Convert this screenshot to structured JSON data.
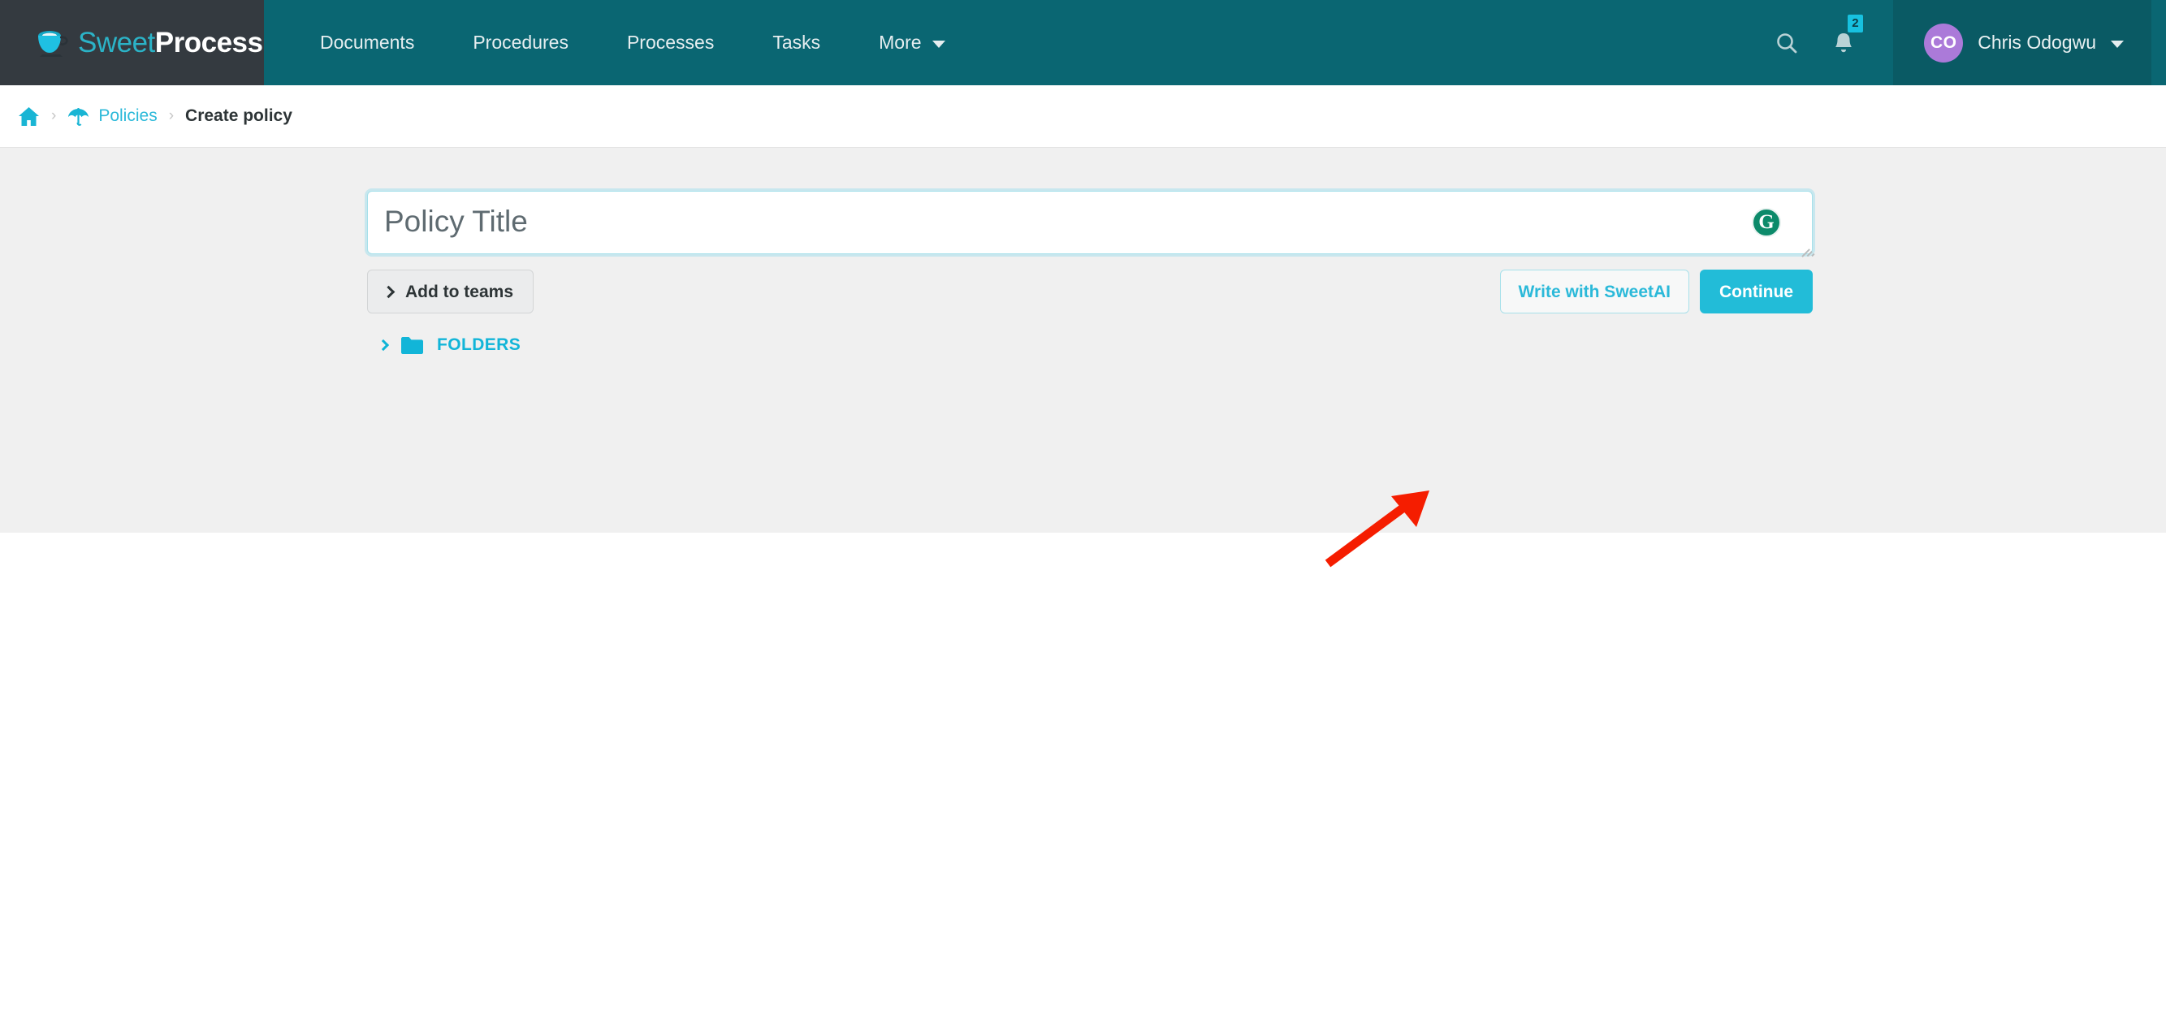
{
  "brand": {
    "name_part1": "Sweet",
    "name_part2": "Process",
    "logo_icon": "coffee-cup-icon",
    "accent_color": "#2bb3c7",
    "header_color": "#0a6672",
    "logo_panel_color": "#343a40"
  },
  "nav": {
    "items": [
      {
        "label": "Documents"
      },
      {
        "label": "Procedures"
      },
      {
        "label": "Processes"
      },
      {
        "label": "Tasks"
      },
      {
        "label": "More",
        "has_dropdown": true
      }
    ],
    "search_icon": "search-icon",
    "notifications_icon": "bell-icon",
    "notifications_count": "2",
    "notification_badge_color": "#17c1e0"
  },
  "user": {
    "initials": "CO",
    "name": "Chris Odogwu",
    "avatar_color": "#ab7ad9",
    "dropdown_icon": "chevron-down-icon"
  },
  "breadcrumb": {
    "home_icon": "home-icon",
    "separator": "›",
    "items": [
      {
        "label": "Policies",
        "icon": "umbrella-icon",
        "is_link": true
      },
      {
        "label": "Create policy",
        "is_link": false
      }
    ]
  },
  "form": {
    "title_input": {
      "value": "",
      "placeholder": "Policy Title"
    },
    "grammarly_icon": "grammarly-g-icon",
    "resize_handle": "resize-grip-icon",
    "add_to_teams_label": "Add to teams",
    "add_to_teams_icon": "chevron-right-icon",
    "write_with_sweetai_label": "Write with SweetAI",
    "continue_label": "Continue",
    "folders_label": "FOLDERS",
    "folders_icon": "folder-icon",
    "folders_expand_icon": "chevron-right-icon",
    "accent_button_color": "#22bcd8",
    "outline_button_color": "#2bb9d9",
    "folders_color": "#12b5d8"
  },
  "annotation": {
    "arrow_icon": "red-arrow-icon",
    "arrow_color": "#f51d00",
    "points_to": "Write with SweetAI"
  }
}
